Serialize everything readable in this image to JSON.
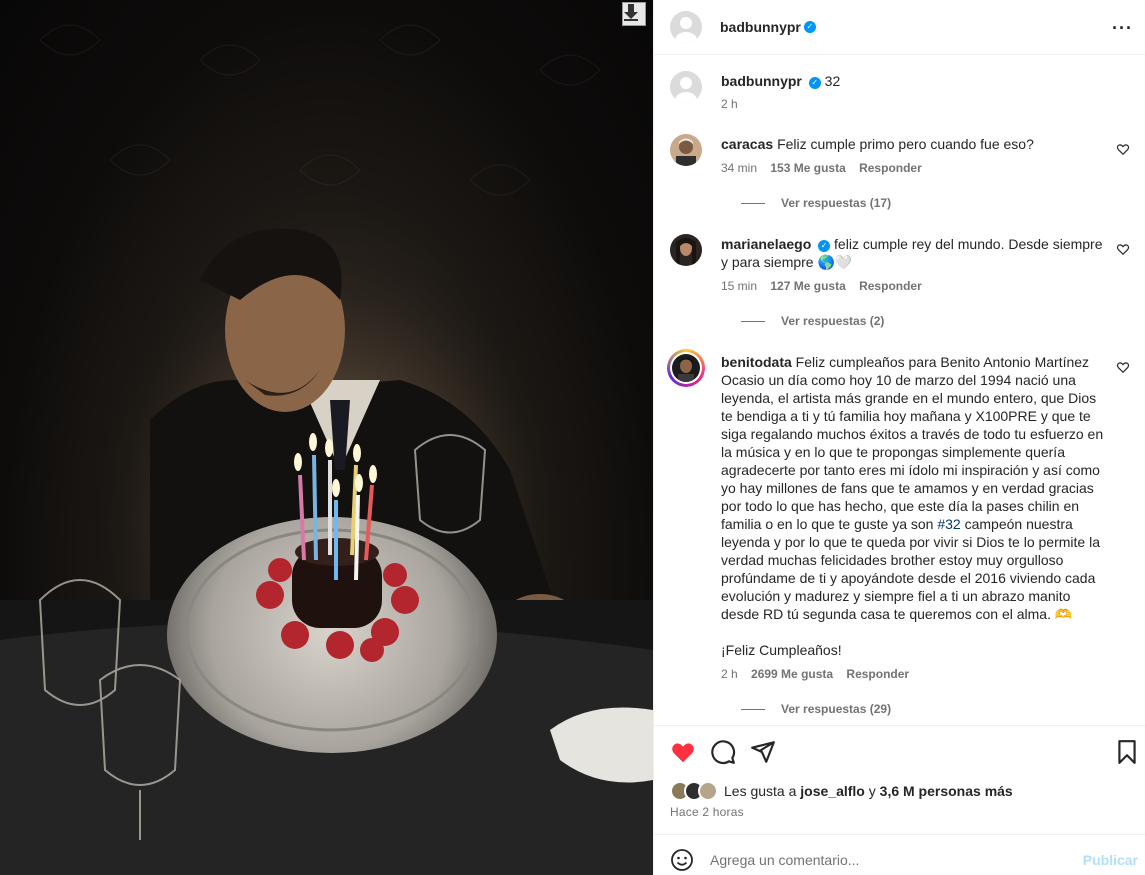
{
  "post": {
    "author": "badbunnypr",
    "verified_icon": "verified-badge-icon",
    "more_icon": "more-options-icon"
  },
  "caption": {
    "username": "badbunnypr",
    "text": "32",
    "time": "2 h"
  },
  "comments": [
    {
      "username": "caracas",
      "text": "Feliz cumple primo pero cuando fue eso?",
      "time": "34 min",
      "likes": "153 Me gusta",
      "reply": "Responder",
      "view_replies": "Ver respuestas (17)"
    },
    {
      "username": "marianelaego",
      "verified": true,
      "text": "feliz cumple rey del mundo. Desde siempre y para siempre 🌎🤍",
      "time": "15 min",
      "likes": "127 Me gusta",
      "reply": "Responder",
      "view_replies": "Ver respuestas (2)"
    },
    {
      "username": "benitodata",
      "text_before_tag": "Feliz cumpleaños para Benito Antonio Martínez Ocasio un día como hoy 10 de marzo del 1994 nació una leyenda, el artista más grande en el mundo entero, que Dios te bendiga a ti y tú familia hoy mañana y X100PRE y que te siga regalando muchos éxitos a través de todo tu esfuerzo en la música y en lo que te propongas simplemente quería agradecerte por tanto eres mi ídolo mi inspiración y así como yo hay millones de fans que te amamos y en verdad gracias por todo lo que has hecho, que este día la pases chilin en familia o en lo que te guste ya son",
      "hashtag": "#32",
      "text_after_tag": "campeón nuestra leyenda y por lo que te queda por vivir si Dios te lo permite la verdad muchas felicidades brother estoy muy orgulloso profúndame de ti y apoyándote desde el 2016 viviendo cada evolución y madurez y siempre fiel a ti un abrazo manito desde RD tú segunda casa te queremos con el alma. 🫶",
      "text_line2": "¡Feliz Cumpleaños!",
      "time": "2 h",
      "likes": "2699 Me gusta",
      "reply": "Responder",
      "view_replies": "Ver respuestas (29)"
    }
  ],
  "actions": {
    "like_icon": "heart-filled-icon",
    "comment_icon": "comment-icon",
    "share_icon": "share-icon",
    "save_icon": "bookmark-icon",
    "like_color": "#ff3040"
  },
  "likes": {
    "prefix": "Les gusta a",
    "user": "jose_alflo",
    "connector": "y",
    "count": "3,6 M personas más"
  },
  "posted_ago": "Hace 2 horas",
  "comment_box": {
    "placeholder": "Agrega un comentario...",
    "publish": "Publicar",
    "emoji_icon": "emoji-icon"
  },
  "photo": {
    "download_icon": "download-icon"
  }
}
